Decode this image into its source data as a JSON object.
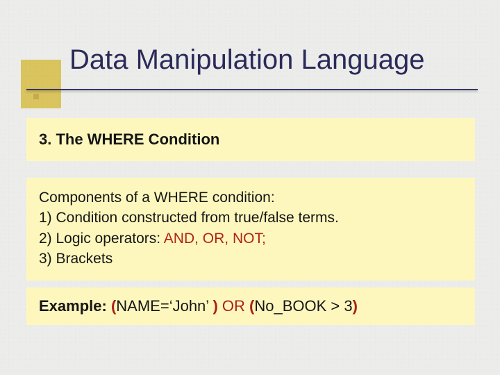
{
  "title": "Data Manipulation Language",
  "section": {
    "heading": "3. The WHERE Condition"
  },
  "body": {
    "intro": "Components of a WHERE condition:",
    "item1": "1) Condition constructed from true/false terms.",
    "item2_prefix": "2) Logic operators: ",
    "item2_ops": "AND, OR, NOT;",
    "item3": "3) Brackets"
  },
  "example": {
    "label": "Example:",
    "lp1": "(",
    "expr1": "NAME=‘John’ ",
    "rp1": ")",
    "or": "OR",
    "lp2": "(",
    "expr2": "No_BOOK > 3",
    "rp2": ")"
  }
}
